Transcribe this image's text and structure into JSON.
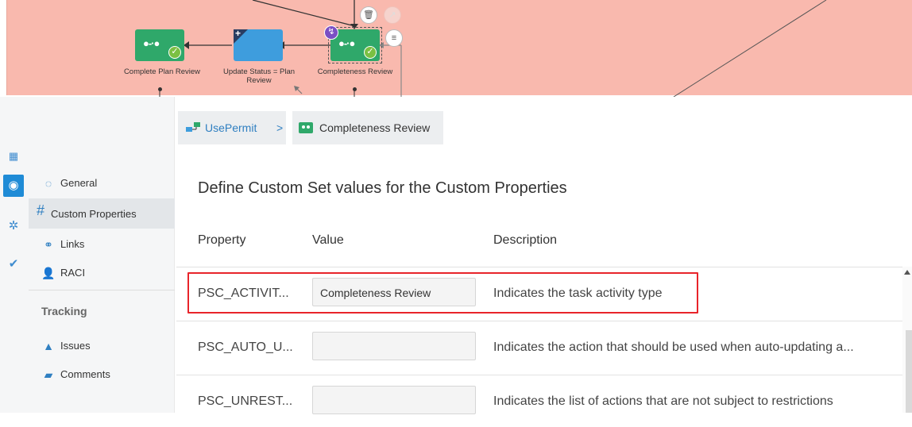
{
  "canvas": {
    "nodes": [
      {
        "label": "Complete Plan Review"
      },
      {
        "label": "Update Status = Plan Review"
      },
      {
        "label": "Completeness Review"
      }
    ],
    "tools": {
      "delete": "🗑",
      "link": "↗",
      "menu": "≡",
      "badge": "↯"
    }
  },
  "rail": {
    "icons": [
      "grid-icon",
      "chat-icon",
      "gear-icon",
      "check-icon"
    ]
  },
  "nav": {
    "items": [
      {
        "label": "General"
      },
      {
        "label": "Custom Properties"
      },
      {
        "label": "Links"
      },
      {
        "label": "RACI"
      }
    ],
    "tracking": {
      "heading": "Tracking",
      "items": [
        {
          "label": "Issues"
        },
        {
          "label": "Comments"
        }
      ]
    }
  },
  "breadcrumb": {
    "root": "UsePermit",
    "separator": ">",
    "current": "Completeness Review"
  },
  "content": {
    "title": "Define Custom Set values for the Custom Properties",
    "columns": {
      "property": "Property",
      "value": "Value",
      "description": "Description"
    },
    "rows": [
      {
        "property": "PSC_ACTIVIT...",
        "value": "Completeness Review",
        "description": "Indicates the task activity type"
      },
      {
        "property": "PSC_AUTO_U...",
        "value": "",
        "description": "Indicates the action that should be used when auto-updating a..."
      },
      {
        "property": "PSC_UNREST...",
        "value": "",
        "description": "Indicates the list of actions that are not subject to restrictions"
      }
    ]
  },
  "colors": {
    "canvas_bg": "#f9b9ae",
    "accent": "#1f8bd6",
    "highlight": "#e8242a",
    "task_green": "#2fa86a",
    "task_blue": "#3e9ddd"
  }
}
